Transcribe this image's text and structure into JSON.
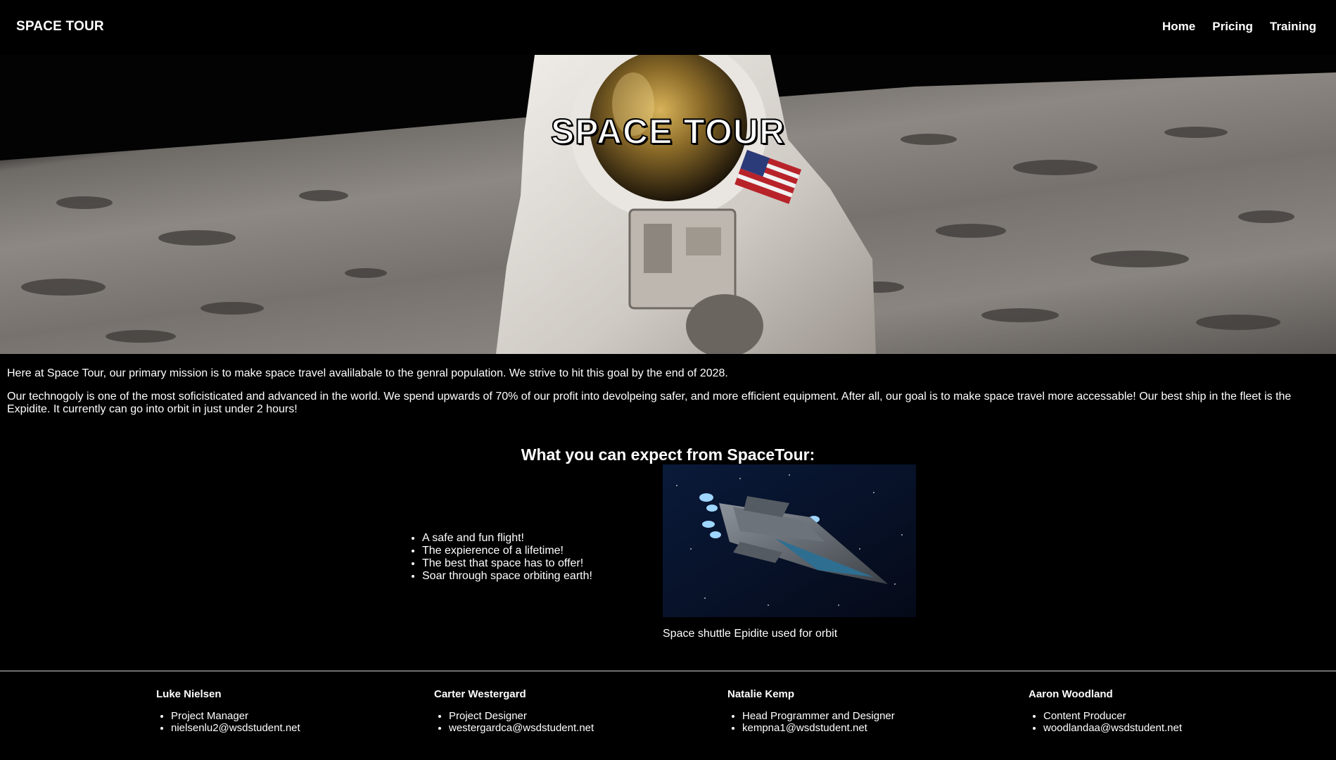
{
  "nav": {
    "brand": "SPACE TOUR",
    "links": [
      "Home",
      "Pricing",
      "Training"
    ]
  },
  "hero": {
    "title": "SPACE TOUR"
  },
  "intro": {
    "paragraph1": "Here at Space Tour, our primary mission is to make space travel avalilabale to the genral population. We strive to hit this goal by the end of 2028.",
    "paragraph2": "Our technogoly is one of the most soficisticated and advanced in the world. We spend upwards of 70% of our profit into devolpeing safer, and more efficient equipment. After all, our goal is to make space travel more accessable! Our best ship in the fleet is the Expidite. It currently can go into orbit in just under 2 hours!"
  },
  "expect": {
    "heading": "What you can expect from SpaceTour:",
    "items": [
      "A safe and fun flight!",
      "The expierence of a lifetime!",
      "The best that space has to offer!",
      "Soar through space orbiting earth!"
    ],
    "caption": "Space shuttle Epidite used for orbit"
  },
  "team": [
    {
      "name": "Luke Nielsen",
      "role": "Project Manager",
      "email": "nielsenlu2@wsdstudent.net"
    },
    {
      "name": "Carter Westergard",
      "role": "Project Designer",
      "email": "westergardca@wsdstudent.net"
    },
    {
      "name": "Natalie Kemp",
      "role": "Head Programmer and Designer",
      "email": "kempna1@wsdstudent.net"
    },
    {
      "name": "Aaron Woodland",
      "role": "Content Producer",
      "email": "woodlandaa@wsdstudent.net"
    }
  ],
  "colors": {
    "background": "#000000",
    "text": "#ffffff",
    "loading_bar": "#1f6fd1"
  }
}
